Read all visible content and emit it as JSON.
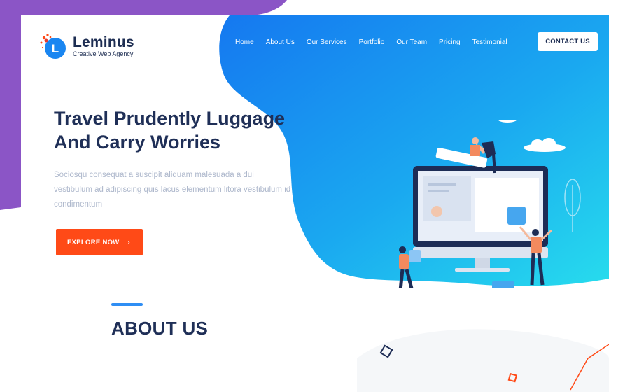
{
  "brand": {
    "name": "Leminus",
    "tagline": "Creative Web Agency",
    "logo_letter": "L",
    "colors": {
      "purple": "#8e54c8",
      "blue": "#1a86f1",
      "cyan": "#25d3ef",
      "orange": "#ff4a17",
      "navy": "#1f2f57"
    }
  },
  "nav": {
    "items": [
      "Home",
      "About Us",
      "Our  Services",
      "Portfolio",
      "Our Team",
      "Pricing",
      "Testimonial"
    ],
    "cta": "CONTACT US"
  },
  "hero": {
    "title_line1": "Travel Prudently Luggage",
    "title_line2": "And Carry Worries",
    "subtitle": "Sociosqu consequat a suscipit aliquam malesuada a dui vestibulum ad adipiscing quis lacus elementum litora vestibulum id condimentum",
    "button": "EXPLORE NOW",
    "button_icon": "arrow-right-icon",
    "illustration": "team-building-website-illustration"
  },
  "about": {
    "title": "ABOUT US"
  }
}
